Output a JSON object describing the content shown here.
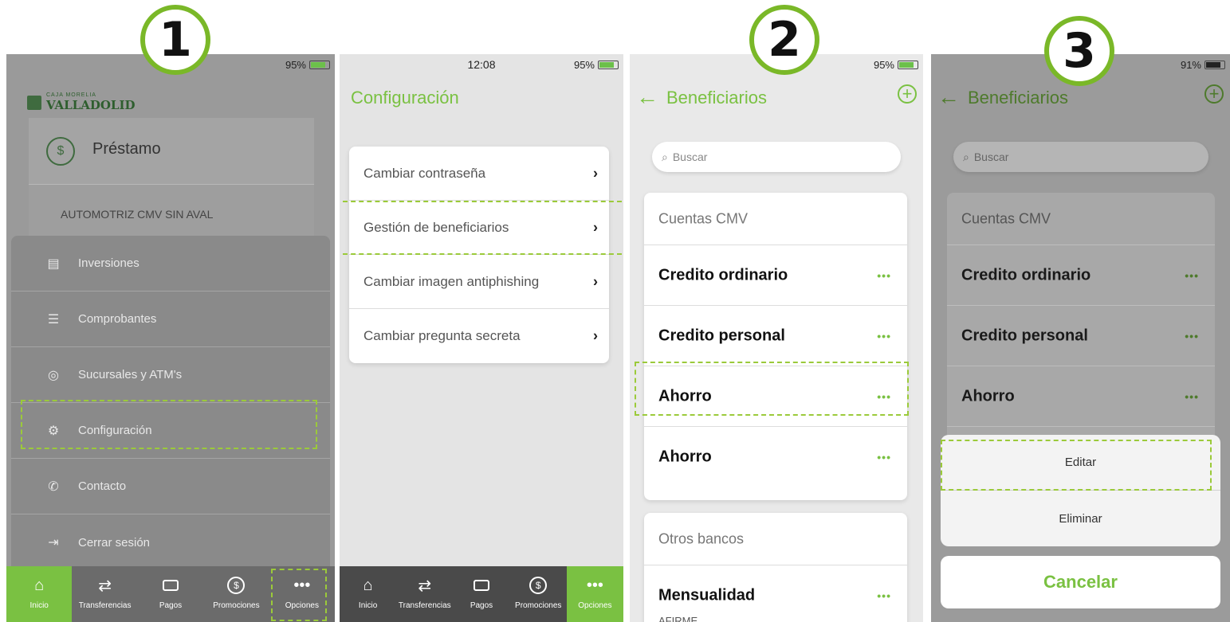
{
  "steps": [
    "1",
    "2",
    "3"
  ],
  "colors": {
    "accent": "#7ac142",
    "highlight": "#9bca3a",
    "nav_bg": "#4a4a4a"
  },
  "phone1": {
    "status": {
      "battery": "95%"
    },
    "bank_name": "VALLADOLID",
    "bank_small": "CAJA MORELIA",
    "loan_title": "Préstamo",
    "loan_item": "AUTOMOTRIZ CMV SIN AVAL",
    "menu": [
      {
        "label": "Inversiones",
        "icon": "document-icon"
      },
      {
        "label": "Comprobantes",
        "icon": "receipt-icon"
      },
      {
        "label": "Sucursales y ATM's",
        "icon": "location-pin-icon"
      },
      {
        "label": "Configuración",
        "icon": "gear-icon"
      },
      {
        "label": "Contacto",
        "icon": "phone-icon"
      },
      {
        "label": "Cerrar sesión",
        "icon": "logout-icon"
      }
    ]
  },
  "phone2": {
    "status": {
      "time": "12:08",
      "battery": "95%"
    },
    "title": "Configuración",
    "items": [
      "Cambiar contraseña",
      "Gestión de beneficiarios",
      "Cambiar imagen antiphishing",
      "Cambiar pregunta secreta"
    ]
  },
  "phone3": {
    "status": {
      "battery": "95%"
    },
    "title": "Beneficiarios",
    "search_placeholder": "Buscar",
    "section_cmv": "Cuentas CMV",
    "accounts": [
      "Credito ordinario",
      "Credito personal",
      "Ahorro",
      "Ahorro"
    ],
    "section_other": "Otros bancos",
    "other_accounts": [
      "Mensualidad"
    ],
    "other_sub": "AFIRME",
    "dots": "•••"
  },
  "phone4": {
    "status": {
      "battery": "91%"
    },
    "title": "Beneficiarios",
    "search_placeholder": "Buscar",
    "section_cmv": "Cuentas CMV",
    "accounts": [
      "Credito ordinario",
      "Credito personal",
      "Ahorro"
    ],
    "actions": {
      "edit": "Editar",
      "delete": "Eliminar",
      "cancel": "Cancelar"
    },
    "dots": "•••"
  },
  "nav": {
    "items": [
      {
        "label": "Inicio",
        "icon": "home-icon"
      },
      {
        "label": "Transferencias",
        "icon": "transfer-icon"
      },
      {
        "label": "Pagos",
        "icon": "wallet-icon"
      },
      {
        "label": "Promociones",
        "icon": "dollar-circle-icon"
      },
      {
        "label": "Opciones",
        "icon": "more-dots-icon"
      }
    ]
  }
}
